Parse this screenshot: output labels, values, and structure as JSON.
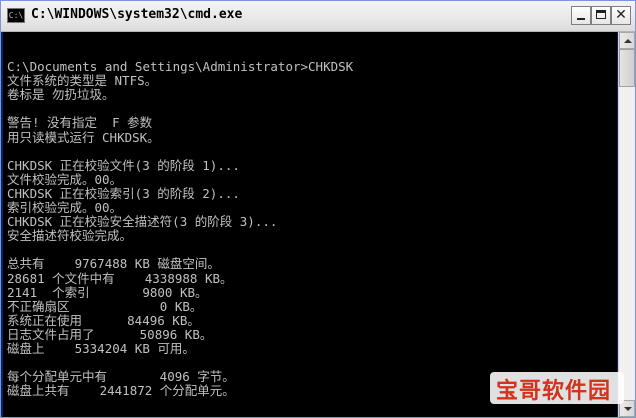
{
  "window": {
    "title": "C:\\WINDOWS\\system32\\cmd.exe",
    "icon_text": "C:\\"
  },
  "console": {
    "lines": [
      "",
      "C:\\Documents and Settings\\Administrator>CHKDSK",
      "文件系统的类型是 NTFS。",
      "卷标是 勿扔垃圾。",
      "",
      "警告! 没有指定  F 参数",
      "用只读模式运行 CHKDSK。",
      "",
      "CHKDSK 正在校验文件(3 的阶段 1)...",
      "文件校验完成。00。",
      "CHKDSK 正在校验索引(3 的阶段 2)...",
      "索引校验完成。00。",
      "CHKDSK 正在校验安全描述符(3 的阶段 3)...",
      "安全描述符校验完成。",
      "",
      "总共有    9767488 KB 磁盘空间。",
      "28681 个文件中有    4338988 KB。",
      "2141  个索引       9800 KB。",
      "不正确扇区            0 KB。",
      "系统正在使用      84496 KB。",
      "日志文件占用了      50896 KB。",
      "磁盘上    5334204 KB 可用。",
      "",
      "每个分配单元中有       4096 字节。",
      "磁盘上共有    2441872 个分配单元。"
    ]
  },
  "watermark": {
    "text": "宝哥软件园"
  },
  "colors": {
    "console_bg": "#000000",
    "console_fg": "#c0c0c0",
    "watermark": "#d2321e"
  }
}
